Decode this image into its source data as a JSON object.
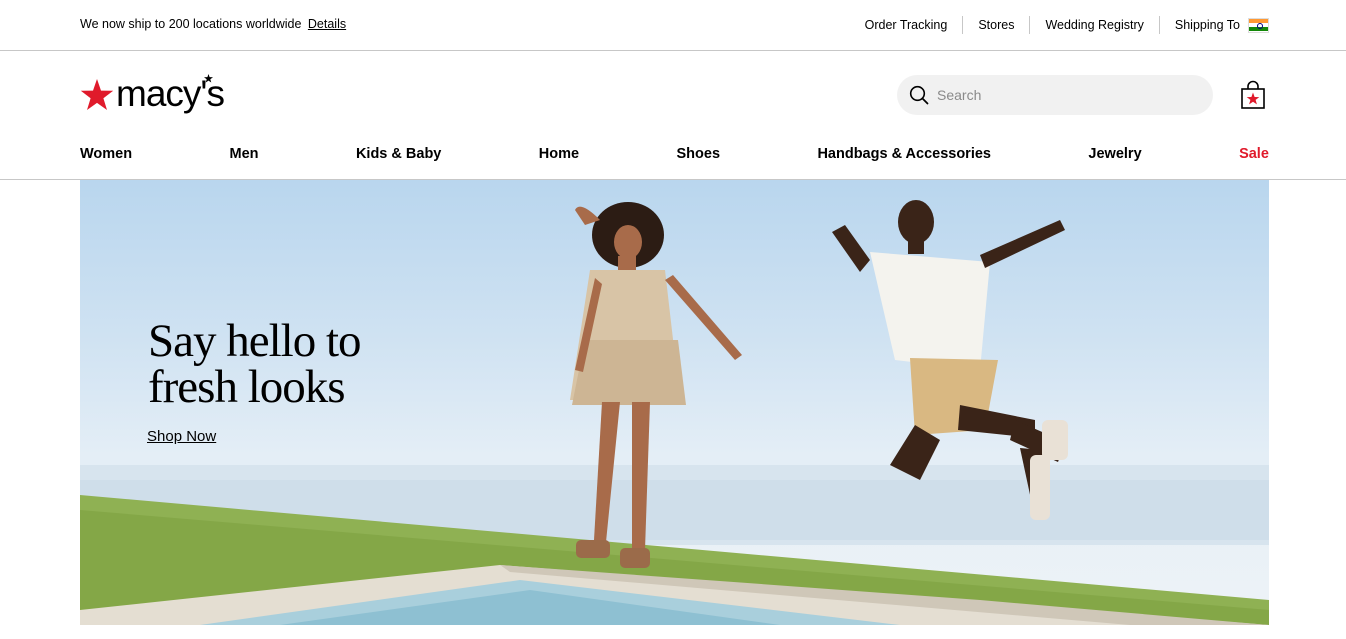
{
  "utility": {
    "ship_message": "We now ship to 200 locations worldwide",
    "details_link": "Details",
    "links": {
      "order_tracking": "Order Tracking",
      "stores": "Stores",
      "wedding_registry": "Wedding Registry",
      "shipping_to": "Shipping To"
    },
    "flag_icon": "india-flag-icon"
  },
  "header": {
    "logo_text": "macy's",
    "logo_star_color": "#e01a2b",
    "search": {
      "placeholder": "Search"
    },
    "bag_icon": "shopping-bag-icon"
  },
  "nav": {
    "items": [
      "Women",
      "Men",
      "Kids & Baby",
      "Home",
      "Shoes",
      "Handbags & Accessories",
      "Jewelry",
      "Sale"
    ],
    "sale_color": "#e01a2b"
  },
  "hero": {
    "title_line1": "Say hello to",
    "title_line2": "fresh looks",
    "cta": "Shop Now"
  }
}
